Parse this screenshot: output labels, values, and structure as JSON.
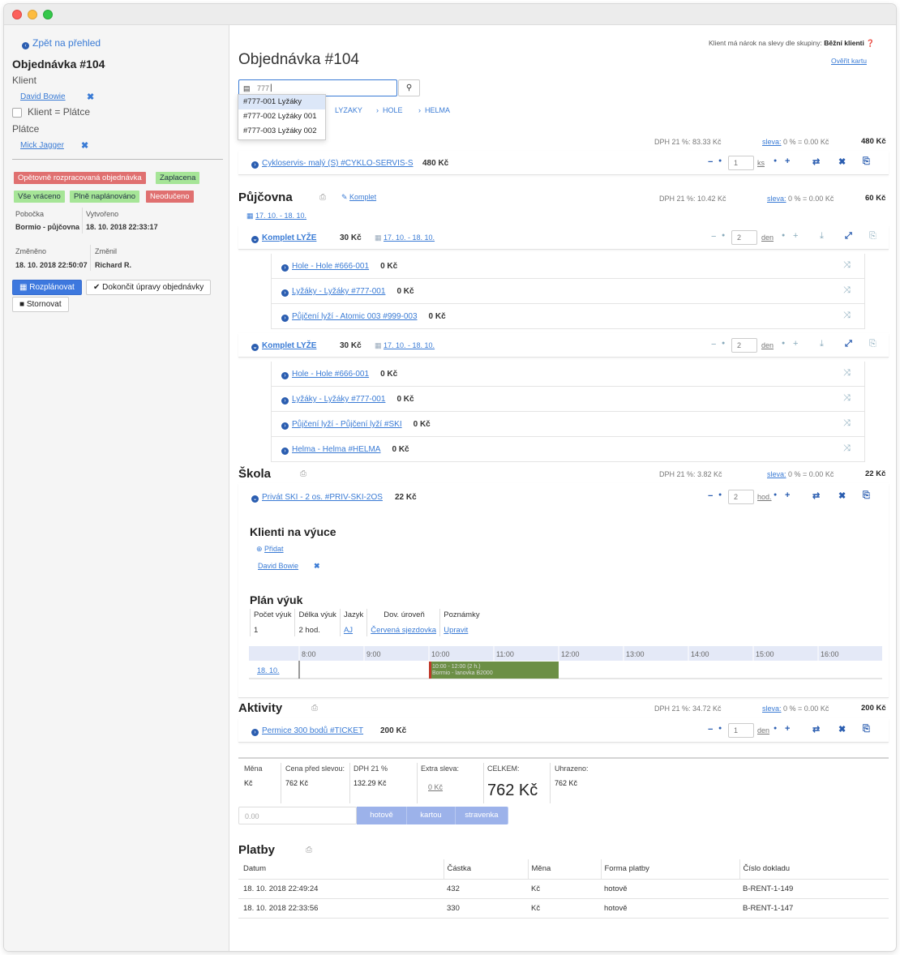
{
  "sidebar": {
    "back": "Zpět na přehled",
    "title": "Objednávka #104",
    "client_label": "Klient",
    "client_name": "David Bowie",
    "client_is_payer": "Klient = Plátce",
    "payer_label": "Plátce",
    "payer_name": "Mick Jagger",
    "badges": [
      {
        "text": "Opětovně rozpracovaná objednávka",
        "color": "red"
      },
      {
        "text": "Zaplacena",
        "color": "green"
      },
      {
        "text": "Vše vráceno",
        "color": "green"
      },
      {
        "text": "Plně naplánováno",
        "color": "green"
      },
      {
        "text": "Neodučeno",
        "color": "red"
      }
    ],
    "branch_label": "Pobočka",
    "branch_value": "Bormio - půjčovna",
    "created_label": "Vytvořeno",
    "created_value": "18. 10. 2018 22:33:17",
    "changed_label": "Změněno",
    "changed_value": "18. 10. 2018 22:50:07",
    "changed_by_label": "Změnil",
    "changed_by_value": "Richard R.",
    "btn_reschedule": "Rozplánovat",
    "btn_finish": "Dokončit úpravy objednávky",
    "btn_cancel": "Stornovat"
  },
  "main": {
    "title": "Objednávka #104",
    "discount_notice": "Klient má nárok na slevy dle skupiny:",
    "discount_group": "Běžní klienti",
    "verify_card": "Ověřit kartu",
    "search_value": "777",
    "search_options": [
      "#777-001 Lyžáky",
      "#777-002 Lyžáky 001",
      "#777-003 Lyžáky 002"
    ],
    "search_tabs": [
      "LYZAKY",
      "HOLE",
      "HELMA"
    ],
    "section_service": {
      "vat": "DPH 21 %: 83.33 Kč",
      "discount": "sleva:",
      "discount_value": "0 % = 0.00 Kč",
      "total": "480 Kč",
      "item": "Cykloservis- malý (S) #CYKLO-SERVIS-S",
      "price": "480 Kč",
      "qty": "1",
      "unit": "ks"
    },
    "section_rental": {
      "title": "Půjčovna",
      "komplet": "Komplet",
      "dates": "17. 10. - 18. 10.",
      "vat": "DPH 21 %: 10.42 Kč",
      "discount": "sleva:",
      "discount_value": "0 % = 0.00 Kč",
      "total": "60 Kč",
      "groups": [
        {
          "name": "Komplet LYŽE",
          "price": "30 Kč",
          "dates": "17. 10. - 18. 10.",
          "qty": "2",
          "unit": "den",
          "items": [
            {
              "name": "Hole - Hole #666-001",
              "price": "0 Kč"
            },
            {
              "name": "Lyžáky - Lyžáky #777-001",
              "price": "0 Kč"
            },
            {
              "name": "Půjčení lyží - Atomic 003 #999-003",
              "price": "0 Kč"
            }
          ]
        },
        {
          "name": "Komplet LYŽE",
          "price": "30 Kč",
          "dates": "17. 10. - 18. 10.",
          "qty": "2",
          "unit": "den",
          "items": [
            {
              "name": "Hole - Hole #666-001",
              "price": "0 Kč"
            },
            {
              "name": "Lyžáky - Lyžáky #777-001",
              "price": "0 Kč"
            },
            {
              "name": "Půjčení lyží - Půjčení lyží #SKI",
              "price": "0 Kč"
            },
            {
              "name": "Helma - Helma #HELMA",
              "price": "0 Kč"
            }
          ]
        }
      ]
    },
    "section_school": {
      "title": "Škola",
      "vat": "DPH 21 %: 3.82 Kč",
      "discount": "sleva:",
      "discount_value": "0 % = 0.00 Kč",
      "total": "22 Kč",
      "item": "Privát SKI - 2 os. #PRIV-SKI-2OS",
      "price": "22 Kč",
      "qty": "2",
      "unit": "hod.",
      "clients_title": "Klienti na výuce",
      "add": "Přidat",
      "client": "David Bowie",
      "plan_title": "Plán výuk",
      "plan_headers": [
        "Počet výuk",
        "Délka výuk",
        "Jazyk",
        "Dov. úroveň",
        "Poznámky"
      ],
      "plan_values": [
        "1",
        "2 hod.",
        "AJ",
        "Červená sjezdovka",
        "Upravit"
      ],
      "timeline_hours": [
        "8:00",
        "9:00",
        "10:00",
        "11:00",
        "12:00",
        "13:00",
        "14:00",
        "15:00",
        "16:00"
      ],
      "timeline_day": "18. 10.",
      "lesson_line1": "10:00 - 12:00 (2 h.)",
      "lesson_line2": "Bormio - lanovka B2000",
      "lesson_start_hour": 10,
      "lesson_end_hour": 12
    },
    "section_activity": {
      "title": "Aktivity",
      "vat": "DPH 21 %: 34.72 Kč",
      "discount": "sleva:",
      "discount_value": "0 % = 0.00 Kč",
      "total": "200 Kč",
      "item": "Permice 300 bodů #TICKET",
      "price": "200 Kč",
      "qty": "1",
      "unit": "den"
    },
    "summary": {
      "currency_label": "Měna",
      "currency": "Kč",
      "pre_discount_label": "Cena před slevou:",
      "pre_discount": "762 Kč",
      "vat_label": "DPH 21 %",
      "vat": "132.29 Kč",
      "extra_label": "Extra sleva:",
      "extra": "0 Kč",
      "total_label": "CELKEM:",
      "total": "762 Kč",
      "paid_label": "Uhrazeno:",
      "paid": "762 Kč"
    },
    "payment_input_placeholder": "0.00",
    "pay_buttons": [
      "hotově",
      "kartou",
      "stravenka"
    ],
    "payments": {
      "title": "Platby",
      "headers": [
        "Datum",
        "Částka",
        "Měna",
        "Forma platby",
        "Číslo dokladu"
      ],
      "rows": [
        [
          "18. 10. 2018 22:49:24",
          "432",
          "Kč",
          "hotově",
          "B-RENT-1-149"
        ],
        [
          "18. 10. 2018 22:33:56",
          "330",
          "Kč",
          "hotově",
          "B-RENT-1-147"
        ]
      ]
    }
  },
  "colors": {
    "accent": "#3a7bd5",
    "lesson": "#6c8f45"
  }
}
